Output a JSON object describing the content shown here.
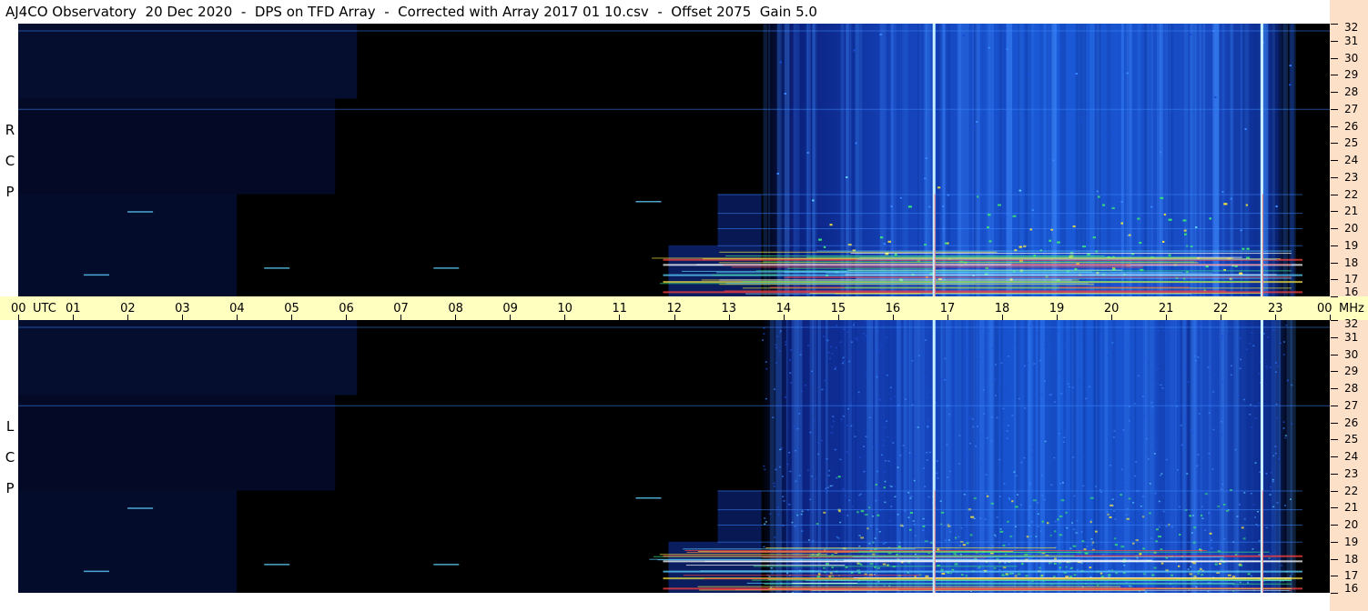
{
  "title": "AJ4CO Observatory  20 Dec 2020  -  DPS on TFD Array  -  Corrected with Array 2017 01 10.csv  -  Offset 2075  Gain 5.0",
  "chart_data": {
    "type": "heatmap",
    "x_axis": {
      "unit_label": "UTC",
      "ticks": [
        "00",
        "01",
        "02",
        "03",
        "04",
        "05",
        "06",
        "07",
        "08",
        "09",
        "10",
        "11",
        "12",
        "13",
        "14",
        "15",
        "16",
        "17",
        "18",
        "19",
        "20",
        "21",
        "22",
        "23",
        "00"
      ],
      "range_hours": [
        0,
        24
      ]
    },
    "y_axis": {
      "unit_label": "MHz",
      "range": [
        16,
        32
      ],
      "ticks": [
        "32",
        "31",
        "30",
        "29",
        "28",
        "27",
        "26",
        "25",
        "24",
        "23",
        "22",
        "21",
        "20",
        "19",
        "18",
        "17",
        "16"
      ]
    },
    "panels": [
      {
        "polarization_letters": [
          "R",
          "C",
          "P"
        ]
      },
      {
        "polarization_letters": [
          "L",
          "C",
          "P"
        ]
      }
    ],
    "colormap": [
      "#000000",
      "#0a1a6e",
      "#1e4fd8",
      "#3a86ff",
      "#5fd0ff",
      "#39e07a",
      "#f0e040",
      "#ff4040",
      "#ffffff"
    ],
    "daylight_rise_utc": 13.6,
    "daylight_end_utc": 23.3,
    "calibration_lines_utc": [
      16.75,
      22.75
    ],
    "interference_bands_mhz": [
      16.3,
      16.9,
      17.3,
      17.9,
      18.2,
      19.0,
      20.0,
      20.9,
      22.0,
      27.0,
      31.6
    ]
  }
}
